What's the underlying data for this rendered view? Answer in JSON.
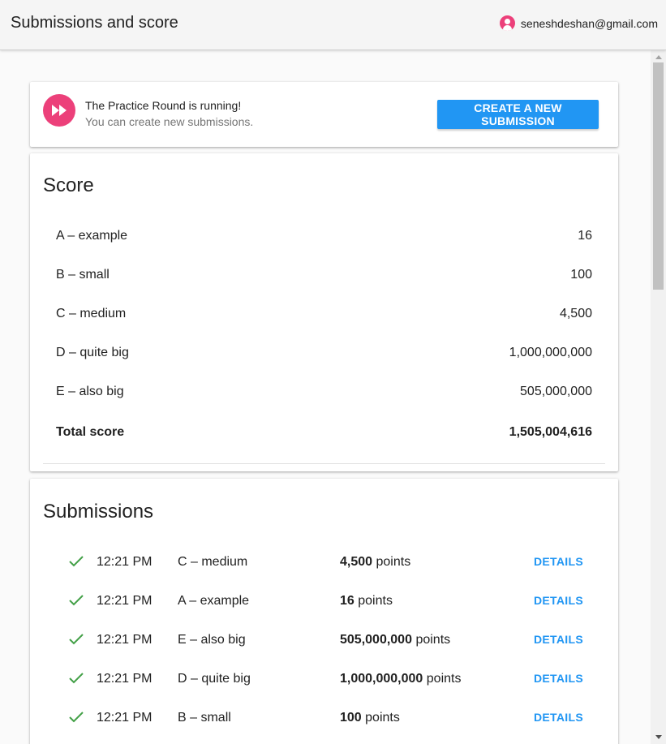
{
  "header": {
    "title": "Submissions and score",
    "account_email": "seneshdeshan@gmail.com"
  },
  "status": {
    "headline": "The Practice Round is running!",
    "subline": "You can create new submissions.",
    "create_button_label": "CREATE A NEW SUBMISSION"
  },
  "score": {
    "title": "Score",
    "rows": [
      {
        "label": "A – example",
        "value": "16"
      },
      {
        "label": "B – small",
        "value": "100"
      },
      {
        "label": "C – medium",
        "value": "4,500"
      },
      {
        "label": "D – quite big",
        "value": "1,000,000,000"
      },
      {
        "label": "E – also big",
        "value": "505,000,000"
      }
    ],
    "total_label": "Total score",
    "total_value": "1,505,004,616"
  },
  "submissions": {
    "title": "Submissions",
    "points_suffix": "points",
    "details_label": "DETAILS",
    "rows": [
      {
        "time": "12:21 PM",
        "task": "C – medium",
        "points": "4,500"
      },
      {
        "time": "12:21 PM",
        "task": "A – example",
        "points": "16"
      },
      {
        "time": "12:21 PM",
        "task": "E – also big",
        "points": "505,000,000"
      },
      {
        "time": "12:21 PM",
        "task": "D – quite big",
        "points": "1,000,000,000"
      },
      {
        "time": "12:21 PM",
        "task": "B – small",
        "points": "100"
      }
    ]
  },
  "icons": {
    "account": "account-circle-icon",
    "round": "fast-forward-icon",
    "status": "check-icon"
  },
  "colors": {
    "accent": "#2196f3",
    "round_icon": "#ec407a",
    "check": "#43a047"
  }
}
